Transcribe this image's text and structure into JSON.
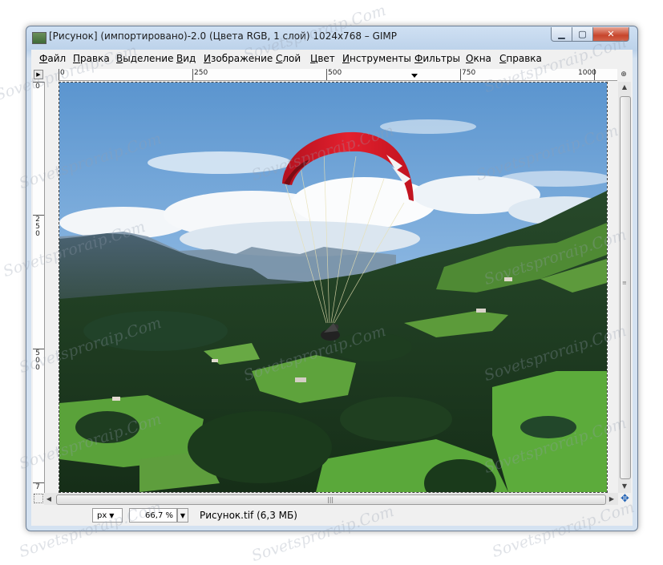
{
  "window": {
    "title": "[Рисунок] (импортировано)-2.0 (Цвета RGB, 1 слой) 1024x768 – GIMP",
    "controls": {
      "minimize": "▁",
      "maximize": "▢",
      "close": "✕"
    }
  },
  "menubar": {
    "items": [
      {
        "first": "Ф",
        "rest": "айл"
      },
      {
        "first": "П",
        "rest": "равка"
      },
      {
        "first": "В",
        "rest": "ыделение"
      },
      {
        "first": "В",
        "rest": "ид"
      },
      {
        "first": "И",
        "rest": "зображение"
      },
      {
        "first": "С",
        "rest": "лой"
      },
      {
        "first": "Ц",
        "rest": "вет"
      },
      {
        "first": "И",
        "rest": "нструменты"
      },
      {
        "first": "Ф",
        "rest": "ильтры"
      },
      {
        "first": "О",
        "rest": "кна"
      },
      {
        "first": "С",
        "rest": "правка"
      }
    ]
  },
  "rulers": {
    "horizontal": [
      "0",
      "250",
      "500",
      "750",
      "1000"
    ],
    "vertical": [
      "0",
      "250",
      "500",
      "7"
    ]
  },
  "icons": {
    "navigation": "navigation-button-icon",
    "zoom_toggle": "zoom-toggle-icon",
    "quick_mask": "quick-mask-icon",
    "navigate": "navigate-cross-icon",
    "scroll_up": "▲",
    "scroll_down": "▼",
    "scroll_left": "◀",
    "scroll_right": "▶",
    "grip": "|||"
  },
  "statusbar": {
    "unit": "px",
    "zoom": "66,7 %",
    "file_info": "Рисунок.tif (6,3 МБ)"
  },
  "watermark": "Sovetsproraip.Com",
  "colors": {
    "title_bg": "#bcd2ea",
    "close_button": "#c7452c",
    "canvas_border": "#444444"
  }
}
